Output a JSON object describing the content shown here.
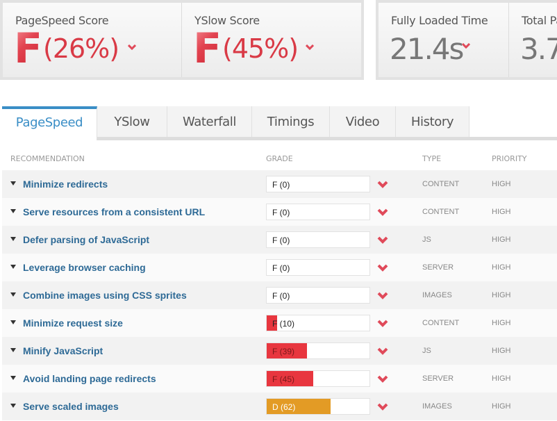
{
  "summary": {
    "pagespeed": {
      "label": "PageSpeed Score",
      "grade": "F",
      "percent": "(26%)",
      "trend": "down"
    },
    "yslow": {
      "label": "YSlow Score",
      "grade": "F",
      "percent": "(45%)",
      "trend": "down"
    },
    "fully_loaded": {
      "label": "Fully Loaded Time",
      "value": "21.4s",
      "trend": "down"
    },
    "total_page": {
      "label": "Total Pa",
      "value": "3.7"
    }
  },
  "tabs": [
    {
      "label": "PageSpeed",
      "active": true
    },
    {
      "label": "YSlow",
      "active": false
    },
    {
      "label": "Waterfall",
      "active": false
    },
    {
      "label": "Timings",
      "active": false
    },
    {
      "label": "Video",
      "active": false
    },
    {
      "label": "History",
      "active": false
    }
  ],
  "table": {
    "headers": {
      "recommendation": "RECOMMENDATION",
      "grade": "GRADE",
      "type": "TYPE",
      "priority": "PRIORITY"
    },
    "rows": [
      {
        "recommendation": "Minimize redirects",
        "grade": "F (0)",
        "score": 0,
        "type": "CONTENT",
        "priority": "HIGH"
      },
      {
        "recommendation": "Serve resources from a consistent URL",
        "grade": "F (0)",
        "score": 0,
        "type": "CONTENT",
        "priority": "HIGH"
      },
      {
        "recommendation": "Defer parsing of JavaScript",
        "grade": "F (0)",
        "score": 0,
        "type": "JS",
        "priority": "HIGH"
      },
      {
        "recommendation": "Leverage browser caching",
        "grade": "F (0)",
        "score": 0,
        "type": "SERVER",
        "priority": "HIGH"
      },
      {
        "recommendation": "Combine images using CSS sprites",
        "grade": "F (0)",
        "score": 0,
        "type": "IMAGES",
        "priority": "HIGH"
      },
      {
        "recommendation": "Minimize request size",
        "grade": "F (10)",
        "score": 10,
        "type": "CONTENT",
        "priority": "HIGH"
      },
      {
        "recommendation": "Minify JavaScript",
        "grade": "F (39)",
        "score": 39,
        "type": "JS",
        "priority": "HIGH"
      },
      {
        "recommendation": "Avoid landing page redirects",
        "grade": "F (45)",
        "score": 45,
        "type": "SERVER",
        "priority": "HIGH"
      },
      {
        "recommendation": "Serve scaled images",
        "grade": "D (62)",
        "score": 62,
        "type": "IMAGES",
        "priority": "HIGH"
      }
    ]
  },
  "colors": {
    "accent": "#3a8ec6",
    "grade_f": "#e8363f",
    "grade_d": "#e39b25",
    "trend_down": "#e04a5a",
    "link": "#2e6a96"
  }
}
